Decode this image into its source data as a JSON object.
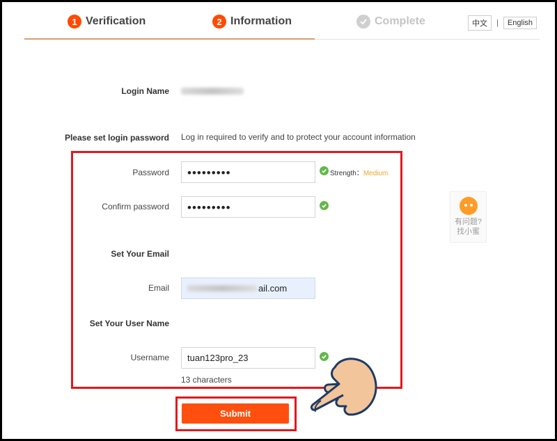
{
  "steps": {
    "step1": {
      "number": "1",
      "label": "Verification"
    },
    "step2": {
      "number": "2",
      "label": "Information"
    },
    "step3": {
      "label": "Complete"
    }
  },
  "language": {
    "chinese": "中文",
    "english": "English"
  },
  "form": {
    "login_name_label": "Login Name",
    "password_section_label": "Please set login password",
    "password_hint": "Log in required to verify and to protect your account information",
    "password_label": "Password",
    "password_value": "•••••••••",
    "strength_label": "Strength：",
    "strength_value": "Medium",
    "confirm_label": "Confirm password",
    "confirm_value": "•••••••••",
    "email_section_label": "Set Your Email",
    "email_label": "Email",
    "email_value_visible": "ail.com",
    "username_section_label": "Set Your User Name",
    "username_label": "Username",
    "username_value": "tuan123pro_23",
    "username_count": "13 characters",
    "submit_label": "Submit"
  },
  "helper": {
    "line1": "有问题?",
    "line2": "找小蜜"
  },
  "colors": {
    "accent": "#ff4f0f",
    "step_active": "#ff4a00",
    "success": "#63b84a",
    "strength_medium": "#f0a42b",
    "highlight_box": "#e0191d"
  }
}
